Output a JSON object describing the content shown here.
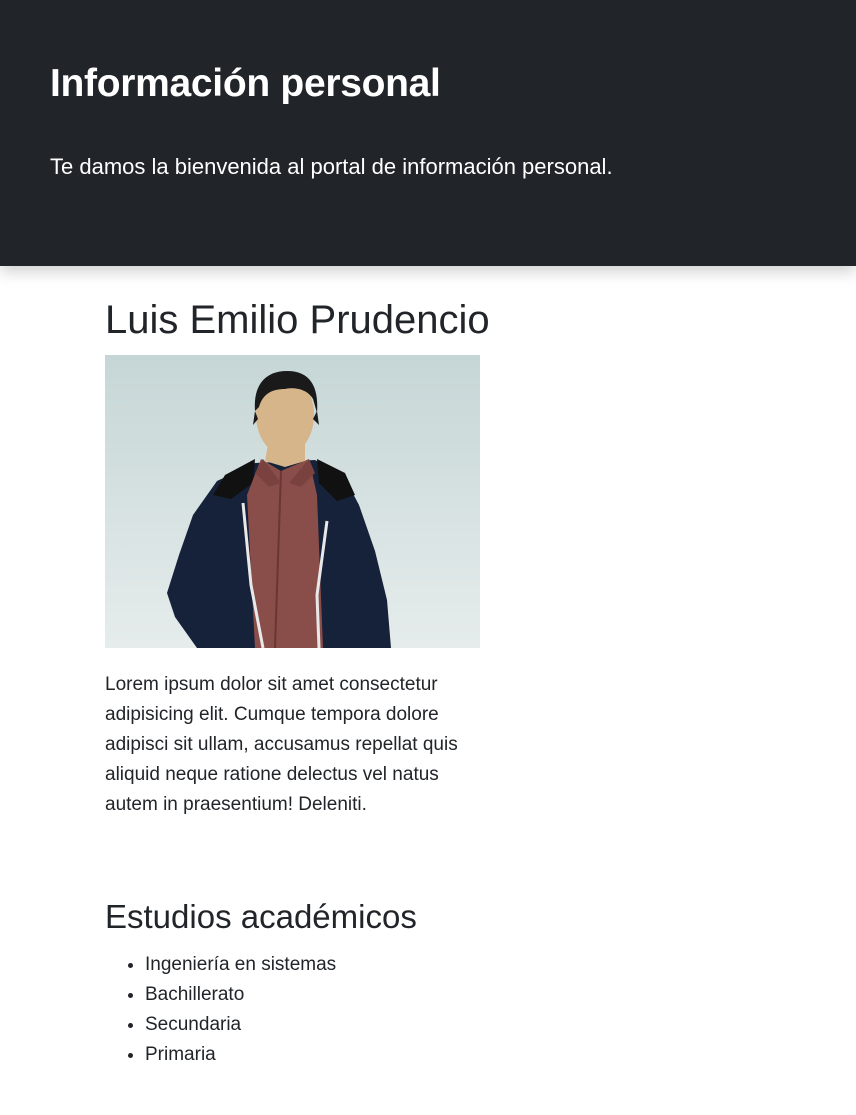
{
  "header": {
    "title": "Información personal",
    "lead": "Te damos la bienvenida al portal de información personal."
  },
  "profile": {
    "name": "Luis Emilio Prudencio",
    "photo_icon": "person-illustration",
    "bio": "Lorem ipsum dolor sit amet consectetur adipisicing elit. Cumque tempora dolore adipisci sit ullam, accusamus repellat quis aliquid neque ratione delectus vel natus autem in praesentium! Deleniti."
  },
  "studies": {
    "title": "Estudios académicos",
    "items": [
      {
        "label": "Ingeniería en sistemas"
      },
      {
        "label": "Bachillerato"
      },
      {
        "label": "Secundaria"
      },
      {
        "label": "Primaria"
      }
    ]
  },
  "colors": {
    "hero_bg": "#212529",
    "text": "#212529",
    "jacket": "#16213a",
    "shirt": "#8a4e4a",
    "skin": "#d6b58a"
  }
}
